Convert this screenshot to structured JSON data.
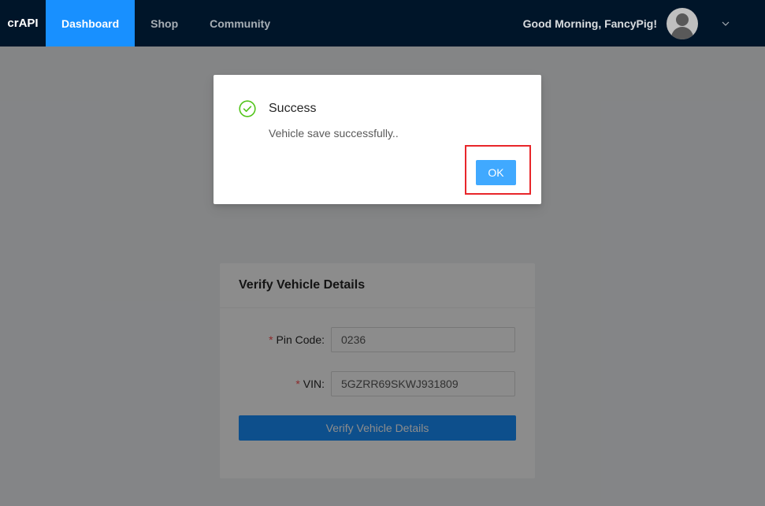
{
  "header": {
    "brand": "crAPI",
    "nav": [
      {
        "label": "Dashboard",
        "active": true
      },
      {
        "label": "Shop",
        "active": false
      },
      {
        "label": "Community",
        "active": false
      }
    ],
    "greeting": "Good Morning, FancyPig!",
    "avatar_icon": "user-avatar-icon",
    "dropdown_icon": "chevron-down-icon"
  },
  "card": {
    "title": "Verify Vehicle Details",
    "required_mark": "*",
    "fields": [
      {
        "label": "Pin Code",
        "value": "0236"
      },
      {
        "label": "VIN",
        "value": "5GZRR69SKWJ931809"
      }
    ],
    "submit_label": "Verify Vehicle Details"
  },
  "modal": {
    "icon": "check-circle-icon",
    "title": "Success",
    "content": "Vehicle save successfully..",
    "ok_label": "OK",
    "highlight_color": "#e8262a"
  },
  "colors": {
    "primary": "#1890ff",
    "header_bg": "#001529",
    "success": "#52c41a",
    "required": "#ff4d4f"
  }
}
